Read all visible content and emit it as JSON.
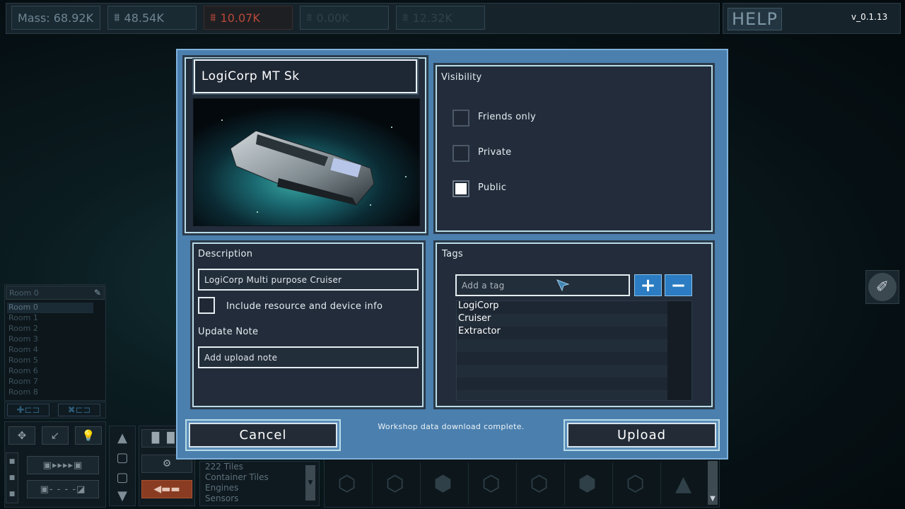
{
  "hud": {
    "mass": "Mass: 68.92K",
    "resource1": "48.54K",
    "resource2": "10.07K",
    "resource3": "0.00K",
    "resource4": "12.32K",
    "help_label": "HELP",
    "version": "v_0.1.13"
  },
  "rooms": {
    "current": "Room 0",
    "items": [
      "Room 0",
      "Room 1",
      "Room 2",
      "Room 3",
      "Room 4",
      "Room 5",
      "Room 6",
      "Room 7",
      "Room 8"
    ]
  },
  "tile_list": {
    "items": [
      "222 Tiles",
      "Container Tiles",
      "Engines",
      "Sensors"
    ]
  },
  "dialog": {
    "ship_name": "LogiCorp MT Sk",
    "visibility": {
      "title": "Visibility",
      "options": [
        {
          "label": "Friends only",
          "checked": false
        },
        {
          "label": "Private",
          "checked": false
        },
        {
          "label": "Public",
          "checked": true
        }
      ]
    },
    "description": {
      "title": "Description",
      "value": "LogiCorp Multi purpose Cruiser",
      "include_label": "Include resource and device info",
      "update_note_title": "Update Note",
      "update_note_placeholder": "Add upload note"
    },
    "tags": {
      "title": "Tags",
      "input_placeholder": "Add a tag",
      "items": [
        "LogiCorp",
        "Cruiser",
        "Extractor"
      ]
    },
    "cancel_label": "Cancel",
    "upload_label": "Upload",
    "status": "Workshop data download complete."
  },
  "colors": {
    "dialog_bg": "#4a7fae",
    "panel_bg": "#222c3a",
    "panel_border": "#b9dce7",
    "accent_button": "#2b7cc2",
    "hud_red": "#b9493a"
  }
}
